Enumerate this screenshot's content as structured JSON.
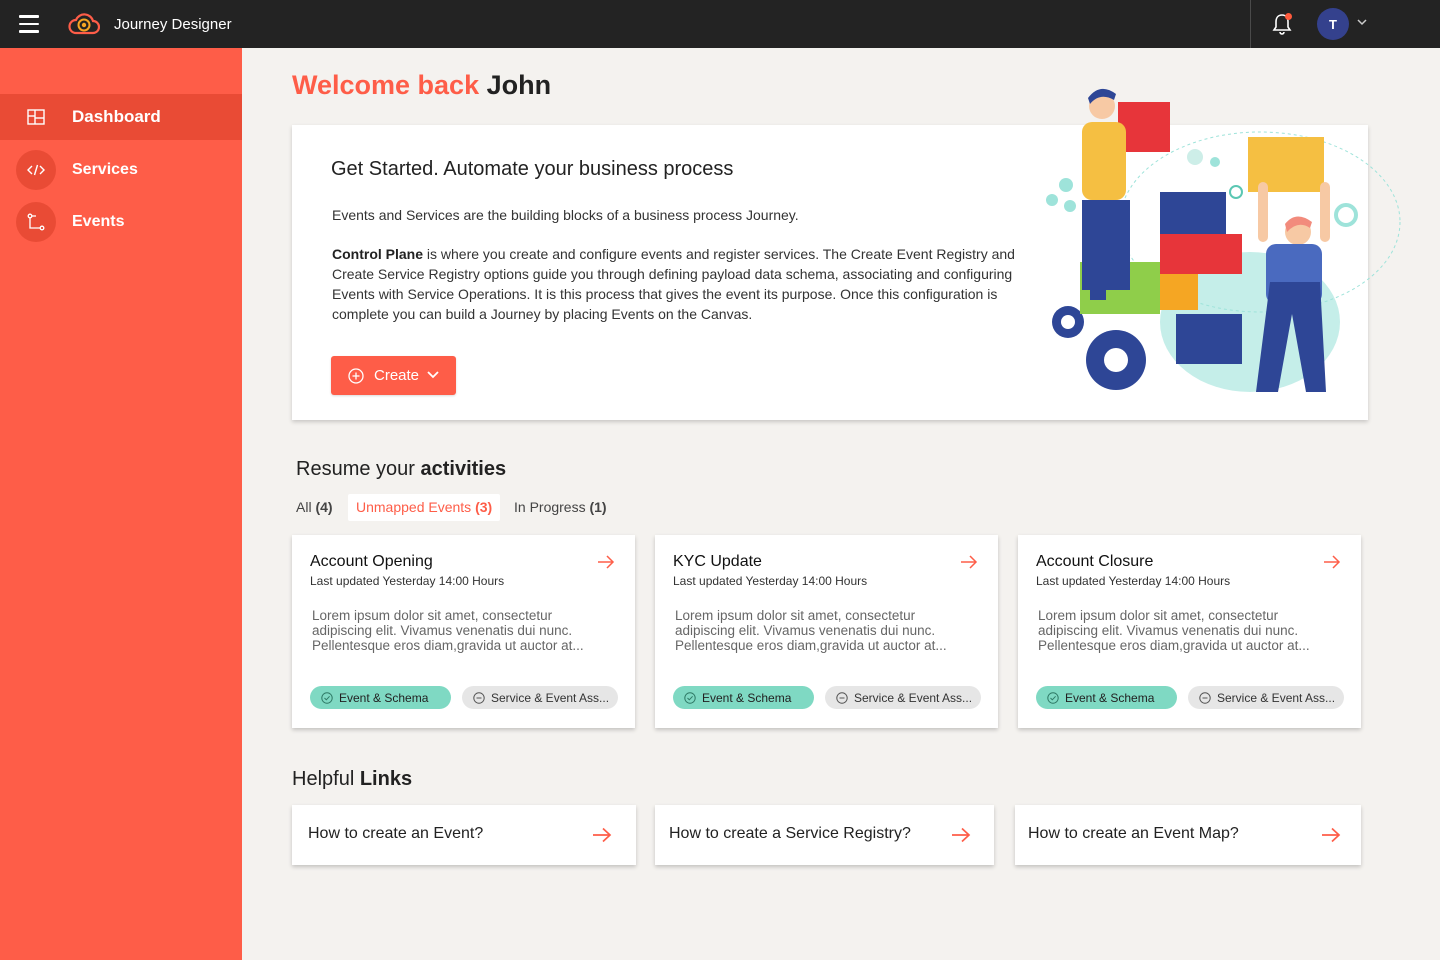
{
  "app": {
    "title": "Journey Designer",
    "user_initial": "T"
  },
  "colors": {
    "accent": "#fe5d48",
    "sidebar": "#fe5d48",
    "topbar": "#232323",
    "success_pill": "#7fd9c3"
  },
  "sidebar": {
    "items": [
      {
        "label": "Dashboard",
        "icon": "dashboard-icon",
        "active": true
      },
      {
        "label": "Services",
        "icon": "code-icon",
        "active": false
      },
      {
        "label": "Events",
        "icon": "flow-icon",
        "active": false
      }
    ]
  },
  "welcome": {
    "prefix": "Welcome back",
    "name": "John"
  },
  "hero": {
    "title": "Get Started. Automate your business process",
    "paragraph1": "Events and Services are the building blocks of a business process Journey.",
    "paragraph2_bold": "Control Plane",
    "paragraph2_rest": " is where you create and configure events and register services. The Create Event Registry and Create Service Registry options guide you through defining payload data schema, associating and configuring Events with Service Operations. It is this process that gives the event its purpose. Once this configuration is complete you can build a Journey by placing Events on the Canvas.",
    "create_label": "Create"
  },
  "activities": {
    "title_prefix": "Resume your",
    "title_bold": "activities",
    "tabs": [
      {
        "label": "All",
        "count": "(4)"
      },
      {
        "label": "Unmapped Events",
        "count": "(3)",
        "active": true
      },
      {
        "label": "In Progress",
        "count": "(1)"
      }
    ],
    "cards": [
      {
        "title": "Account Opening",
        "updated": "Last updated Yesterday 14:00 Hours",
        "description": "Lorem ipsum dolor sit amet, consectetur adipiscing elit. Vivamus venenatis dui nunc. Pellentesque eros diam,gravida ut auctor at...",
        "pill_done": "Event & Schema",
        "pill_pending": "Service & Event Ass..."
      },
      {
        "title": "KYC Update",
        "updated": "Last updated Yesterday 14:00 Hours",
        "description": "Lorem ipsum dolor sit amet, consectetur adipiscing elit. Vivamus venenatis dui nunc. Pellentesque eros diam,gravida ut auctor at...",
        "pill_done": "Event & Schema",
        "pill_pending": "Service & Event Ass..."
      },
      {
        "title": "Account Closure",
        "updated": "Last updated Yesterday 14:00 Hours",
        "description": "Lorem ipsum dolor sit amet, consectetur adipiscing elit. Vivamus venenatis dui nunc. Pellentesque eros diam,gravida ut auctor at...",
        "pill_done": "Event & Schema",
        "pill_pending": "Service & Event Ass..."
      }
    ]
  },
  "links": {
    "title_prefix": "Helpful",
    "title_bold": "Links",
    "items": [
      {
        "label": "How to create an Event?"
      },
      {
        "label": "How to create a Service Registry?"
      },
      {
        "label": "How to create an Event Map?"
      }
    ]
  }
}
